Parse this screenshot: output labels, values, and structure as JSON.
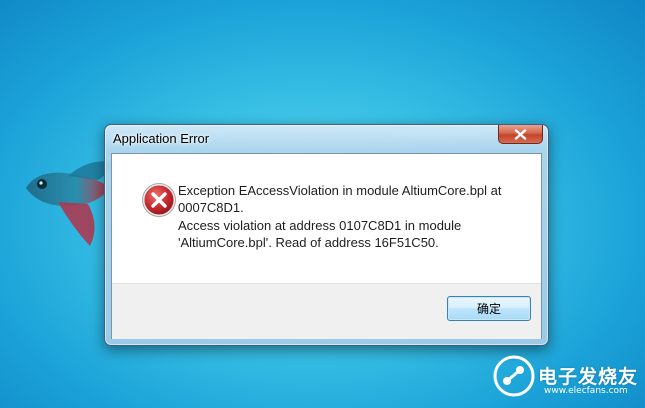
{
  "window": {
    "title": "Application Error",
    "close_icon": "close-icon"
  },
  "message": {
    "icon": "error-icon",
    "lines": [
      "Exception EAccessViolation in module AltiumCore.bpl at",
      "0007C8D1.",
      "Access violation at address 0107C8D1 in module",
      "'AltiumCore.bpl'. Read of address 16F51C50."
    ]
  },
  "buttons": {
    "ok_label": "确定"
  },
  "watermark": {
    "text": "电子发烧友",
    "url": "www.elecfans.com"
  },
  "colors": {
    "desktop": "#2fb6e2",
    "close_button": "#c9482e",
    "error_icon": "#c1272d",
    "button_accent": "#3c7fb1"
  }
}
